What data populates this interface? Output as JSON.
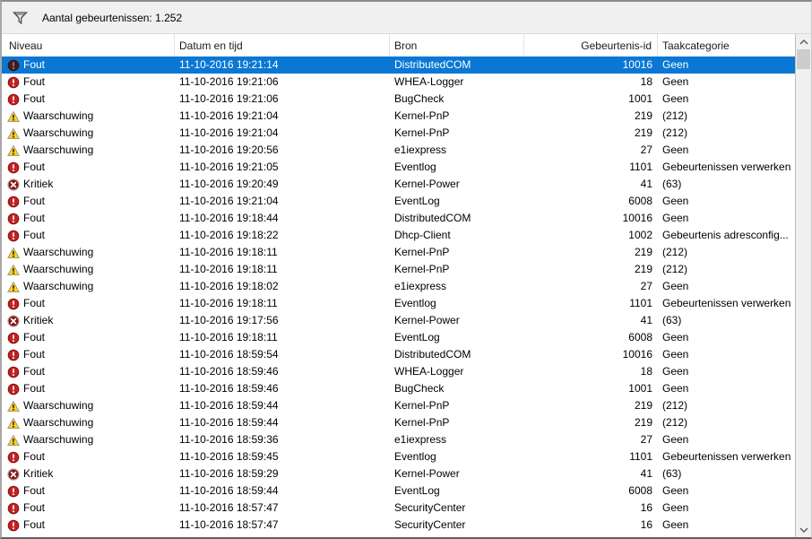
{
  "toolbar": {
    "count_label": "Aantal gebeurtenissen: 1.252"
  },
  "colors": {
    "selection_blue": "#0a77d4",
    "error_red": "#c32222",
    "critical_dark_red": "#8e1212",
    "warning_yellow": "#fcd11c",
    "toolbar_gray": "#f0f0f0",
    "scroll_thumb": "#cdcdcd"
  },
  "table": {
    "columns": [
      {
        "key": "level",
        "label": "Niveau"
      },
      {
        "key": "datetime",
        "label": "Datum en tijd"
      },
      {
        "key": "source",
        "label": "Bron"
      },
      {
        "key": "event_id",
        "label": "Gebeurtenis-id"
      },
      {
        "key": "category",
        "label": "Taakcategorie"
      }
    ],
    "rows": [
      {
        "level": "Fout",
        "icon": "error-icon",
        "datetime": "11-10-2016 19:21:14",
        "source": "DistributedCOM",
        "event_id": "10016",
        "category": "Geen",
        "selected": true
      },
      {
        "level": "Fout",
        "icon": "error-icon",
        "datetime": "11-10-2016 19:21:06",
        "source": "WHEA-Logger",
        "event_id": "18",
        "category": "Geen"
      },
      {
        "level": "Fout",
        "icon": "error-icon",
        "datetime": "11-10-2016 19:21:06",
        "source": "BugCheck",
        "event_id": "1001",
        "category": "Geen"
      },
      {
        "level": "Waarschuwing",
        "icon": "warning-icon",
        "datetime": "11-10-2016 19:21:04",
        "source": "Kernel-PnP",
        "event_id": "219",
        "category": "(212)"
      },
      {
        "level": "Waarschuwing",
        "icon": "warning-icon",
        "datetime": "11-10-2016 19:21:04",
        "source": "Kernel-PnP",
        "event_id": "219",
        "category": "(212)"
      },
      {
        "level": "Waarschuwing",
        "icon": "warning-icon",
        "datetime": "11-10-2016 19:20:56",
        "source": "e1iexpress",
        "event_id": "27",
        "category": "Geen"
      },
      {
        "level": "Fout",
        "icon": "error-icon",
        "datetime": "11-10-2016 19:21:05",
        "source": "Eventlog",
        "event_id": "1101",
        "category": "Gebeurtenissen verwerken"
      },
      {
        "level": "Kritiek",
        "icon": "critical-icon",
        "datetime": "11-10-2016 19:20:49",
        "source": "Kernel-Power",
        "event_id": "41",
        "category": "(63)"
      },
      {
        "level": "Fout",
        "icon": "error-icon",
        "datetime": "11-10-2016 19:21:04",
        "source": "EventLog",
        "event_id": "6008",
        "category": "Geen"
      },
      {
        "level": "Fout",
        "icon": "error-icon",
        "datetime": "11-10-2016 19:18:44",
        "source": "DistributedCOM",
        "event_id": "10016",
        "category": "Geen"
      },
      {
        "level": "Fout",
        "icon": "error-icon",
        "datetime": "11-10-2016 19:18:22",
        "source": "Dhcp-Client",
        "event_id": "1002",
        "category": "Gebeurtenis adresconfig..."
      },
      {
        "level": "Waarschuwing",
        "icon": "warning-icon",
        "datetime": "11-10-2016 19:18:11",
        "source": "Kernel-PnP",
        "event_id": "219",
        "category": "(212)"
      },
      {
        "level": "Waarschuwing",
        "icon": "warning-icon",
        "datetime": "11-10-2016 19:18:11",
        "source": "Kernel-PnP",
        "event_id": "219",
        "category": "(212)"
      },
      {
        "level": "Waarschuwing",
        "icon": "warning-icon",
        "datetime": "11-10-2016 19:18:02",
        "source": "e1iexpress",
        "event_id": "27",
        "category": "Geen"
      },
      {
        "level": "Fout",
        "icon": "error-icon",
        "datetime": "11-10-2016 19:18:11",
        "source": "Eventlog",
        "event_id": "1101",
        "category": "Gebeurtenissen verwerken"
      },
      {
        "level": "Kritiek",
        "icon": "critical-icon",
        "datetime": "11-10-2016 19:17:56",
        "source": "Kernel-Power",
        "event_id": "41",
        "category": "(63)"
      },
      {
        "level": "Fout",
        "icon": "error-icon",
        "datetime": "11-10-2016 19:18:11",
        "source": "EventLog",
        "event_id": "6008",
        "category": "Geen"
      },
      {
        "level": "Fout",
        "icon": "error-icon",
        "datetime": "11-10-2016 18:59:54",
        "source": "DistributedCOM",
        "event_id": "10016",
        "category": "Geen"
      },
      {
        "level": "Fout",
        "icon": "error-icon",
        "datetime": "11-10-2016 18:59:46",
        "source": "WHEA-Logger",
        "event_id": "18",
        "category": "Geen"
      },
      {
        "level": "Fout",
        "icon": "error-icon",
        "datetime": "11-10-2016 18:59:46",
        "source": "BugCheck",
        "event_id": "1001",
        "category": "Geen"
      },
      {
        "level": "Waarschuwing",
        "icon": "warning-icon",
        "datetime": "11-10-2016 18:59:44",
        "source": "Kernel-PnP",
        "event_id": "219",
        "category": "(212)"
      },
      {
        "level": "Waarschuwing",
        "icon": "warning-icon",
        "datetime": "11-10-2016 18:59:44",
        "source": "Kernel-PnP",
        "event_id": "219",
        "category": "(212)"
      },
      {
        "level": "Waarschuwing",
        "icon": "warning-icon",
        "datetime": "11-10-2016 18:59:36",
        "source": "e1iexpress",
        "event_id": "27",
        "category": "Geen"
      },
      {
        "level": "Fout",
        "icon": "error-icon",
        "datetime": "11-10-2016 18:59:45",
        "source": "Eventlog",
        "event_id": "1101",
        "category": "Gebeurtenissen verwerken"
      },
      {
        "level": "Kritiek",
        "icon": "critical-icon",
        "datetime": "11-10-2016 18:59:29",
        "source": "Kernel-Power",
        "event_id": "41",
        "category": "(63)"
      },
      {
        "level": "Fout",
        "icon": "error-icon",
        "datetime": "11-10-2016 18:59:44",
        "source": "EventLog",
        "event_id": "6008",
        "category": "Geen"
      },
      {
        "level": "Fout",
        "icon": "error-icon",
        "datetime": "11-10-2016 18:57:47",
        "source": "SecurityCenter",
        "event_id": "16",
        "category": "Geen"
      },
      {
        "level": "Fout",
        "icon": "error-icon",
        "datetime": "11-10-2016 18:57:47",
        "source": "SecurityCenter",
        "event_id": "16",
        "category": "Geen"
      }
    ]
  }
}
